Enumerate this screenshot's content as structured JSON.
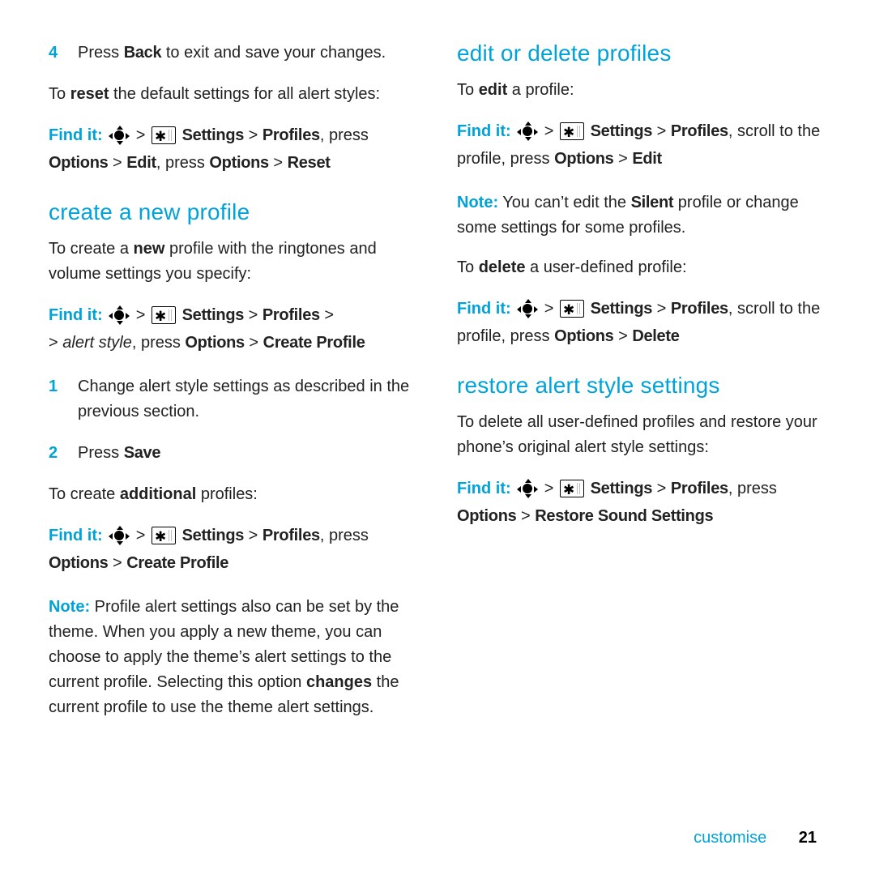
{
  "left": {
    "step4_num": "4",
    "step4_a": "Press ",
    "step4_back": "Back",
    "step4_b": " to exit and save your changes.",
    "reset_a": "To ",
    "reset_bold": "reset",
    "reset_b": " the default settings for all alert styles:",
    "find1_lead": "Find it: ",
    "find1_settings": "Settings",
    "find1_profiles": "Profiles",
    "find1_press": ", press ",
    "find1_options": "Options",
    "find1_edit": "Edit",
    "find1_press2": ", press ",
    "find1_options2": "Options",
    "find1_reset": "Reset",
    "h_create": "create a new profile",
    "create_a": "To create a ",
    "create_new": "new",
    "create_b": " profile with the ringtones and volume settings you specify:",
    "find2_lead": "Find it: ",
    "find2_settings": "Settings",
    "find2_profiles": "Profiles",
    "find2_alert": "alert style",
    "find2_press": ", press ",
    "find2_options": "Options",
    "find2_create": "Create Profile",
    "steps": [
      {
        "n": "1",
        "t": "Change alert style settings as described in the previous section."
      },
      {
        "n": "2",
        "a": "Press ",
        "b": "Save"
      }
    ],
    "addl_a": "To create ",
    "addl_bold": "additional",
    "addl_b": " profiles:",
    "find3_lead": "Find it: ",
    "find3_settings": "Settings",
    "find3_profiles": "Profiles",
    "find3_press": ", press ",
    "find3_options": "Options",
    "find3_create": "Create Profile",
    "note_lead": "Note:",
    "note_a": " Profile alert settings also can be set by the theme. When you apply a new theme, you can choose to apply the theme’s alert settings to the current profile. Selecting this option ",
    "note_changes": "changes",
    "note_b": " the current profile to use the theme alert settings."
  },
  "right": {
    "h_edit": "edit or delete profiles",
    "edit_a": "To ",
    "edit_bold": "edit",
    "edit_b": " a profile:",
    "find4_lead": "Find it: ",
    "find4_settings": "Settings",
    "find4_profiles": "Profiles",
    "find4_scroll": ", scroll to the profile, press ",
    "find4_options": "Options",
    "find4_edit": "Edit",
    "note2_lead": "Note:",
    "note2_a": " You can’t edit the ",
    "note2_silent": "Silent",
    "note2_b": " profile or change some settings for some profiles.",
    "del_a": "To ",
    "del_bold": "delete",
    "del_b": " a user-defined profile:",
    "find5_lead": "Find it: ",
    "find5_settings": "Settings",
    "find5_profiles": "Profiles",
    "find5_scroll": ", scroll to the profile, press ",
    "find5_options": "Options",
    "find5_delete": "Delete",
    "h_restore": "restore alert style settings",
    "restore_a": "To delete all user-defined profiles and restore your phone’s original alert style settings:",
    "find6_lead": "Find it: ",
    "find6_settings": "Settings",
    "find6_profiles": "Profiles",
    "find6_press": ", press ",
    "find6_options": "Options",
    "find6_restore": "Restore Sound Settings"
  },
  "footer": {
    "section": "customise",
    "page": "21"
  },
  "gt": " > "
}
